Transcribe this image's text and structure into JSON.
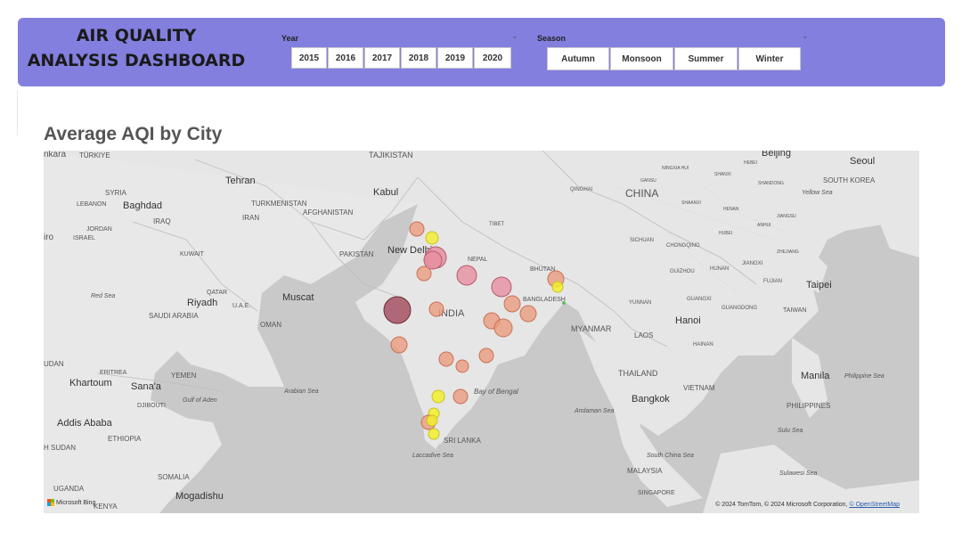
{
  "header": {
    "title_line1": "AIR QUALITY",
    "title_line2": "ANALYSIS DASHBOARD",
    "background": "#837fdf"
  },
  "year_slicer": {
    "label": "Year",
    "chevron": "chevron-down-icon",
    "options": [
      "2015",
      "2016",
      "2017",
      "2018",
      "2019",
      "2020"
    ]
  },
  "season_slicer": {
    "label": "Season",
    "chevron": "chevron-down-icon",
    "options": [
      "Autumn",
      "Monsoon",
      "Summer",
      "Winter"
    ]
  },
  "map_visual": {
    "title": "Average AQI by City",
    "labels": {
      "turkiye": "TÜRKIYE",
      "ankara": "nkara",
      "tajikistan": "TAJIKISTAN",
      "turkmenistan": "TURKMENISTAN",
      "syria": "SYRIA",
      "lebanon": "LEBANON",
      "baghdad": "Baghdad",
      "iraq": "IRAQ",
      "jordan": "JORDAN",
      "israel": "ISRAEL",
      "cairo": "iro",
      "tehran": "Tehran",
      "iran": "IRAN",
      "kabul": "Kabul",
      "afghanistan": "AFGHANISTAN",
      "kuwait": "KUWAIT",
      "pakistan": "PAKISTAN",
      "new_delhi": "New Delhi",
      "nepal": "NEPAL",
      "tibet": "TIBET",
      "bhutan": "BHUTAN",
      "bangladesh": "BANGLADESH",
      "india": "INDIA",
      "myanmar": "MYANMAR",
      "qatar": "QATAR",
      "riyadh": "Riyadh",
      "uae": "U.A.E.",
      "saudi_arabia": "SAUDI ARABIA",
      "muscat": "Muscat",
      "oman": "OMAN",
      "red_sea": "Red Sea",
      "yemen": "YEMEN",
      "eritrea": "ERITREA",
      "sudan": "UDAN",
      "khartoum": "Khartoum",
      "sanaa": "Sana'a",
      "djibouti": "DJIBOUTI",
      "gulf_aden": "Gulf of Aden",
      "addis_ababa": "Addis Ababa",
      "ethiopia": "ETHIOPIA",
      "south_sudan": "H SUDAN",
      "somalia": "SOMALIA",
      "mogadishu": "Mogadishu",
      "uganda": "UGANDA",
      "kenya": "KENYA",
      "arabian_sea": "Arabian Sea",
      "bay_of_bengal": "Bay of Bengal",
      "andaman_sea": "Andaman Sea",
      "sri_lanka": "SRI LANKA",
      "laccadive_sea": "Laccadive Sea",
      "china": "CHINA",
      "beijing": "Beijing",
      "seoul": "Seoul",
      "south_korea": "SOUTH KOREA",
      "yellow_sea": "Yellow Sea",
      "qinghai": "QINGHAI",
      "sichuan": "SICHUAN",
      "chongqing": "CHONGQING",
      "guizhou": "GUIZHOU",
      "yunnan": "YUNNAN",
      "hunan": "HUNAN",
      "jiangxi": "JIANGXI",
      "fujian": "FUJIAN",
      "guangxi": "GUANGXI",
      "guangdong": "GUANGDONG",
      "taipei": "Taipei",
      "taiwan": "TAIWAN",
      "hanoi": "Hanoi",
      "laos": "LAOS",
      "hainan": "HAINAN",
      "thailand": "THAILAND",
      "bangkok": "Bangkok",
      "vietnam": "VIETNAM",
      "manila": "Manila",
      "philippines": "PHILIPPINES",
      "philippine_sea": "Philippine Sea",
      "sulu_sea": "Sulu Sea",
      "south_china_sea": "South China Sea",
      "malaysia": "MALAYSIA",
      "singapore": "SINGAPORE",
      "sulawesi_sea": "Sulawesi Sea",
      "shanxi": "SHANXI",
      "hebei": "HEBEI",
      "shandong": "SHANDONG",
      "henan": "HENAN",
      "hubei": "HUBEI",
      "anhui": "ANHUI",
      "jiangsu": "JIANGSU",
      "zhejiang": "ZHEJIANG",
      "shaanxi": "SHAANXI",
      "ningxia": "NINGXIA HUI",
      "gansu": "GANSU"
    },
    "bing_label": "Microsoft Bing",
    "attribution": "© 2024 TomTom, © 2024 Microsoft Corporation, ",
    "attribution_link": "© OpenStreetMap",
    "bubble_colors": {
      "low": "#f2ef2e",
      "mid": "#eb9c80",
      "high": "#e68fa0",
      "very_high": "#a85a68"
    }
  }
}
